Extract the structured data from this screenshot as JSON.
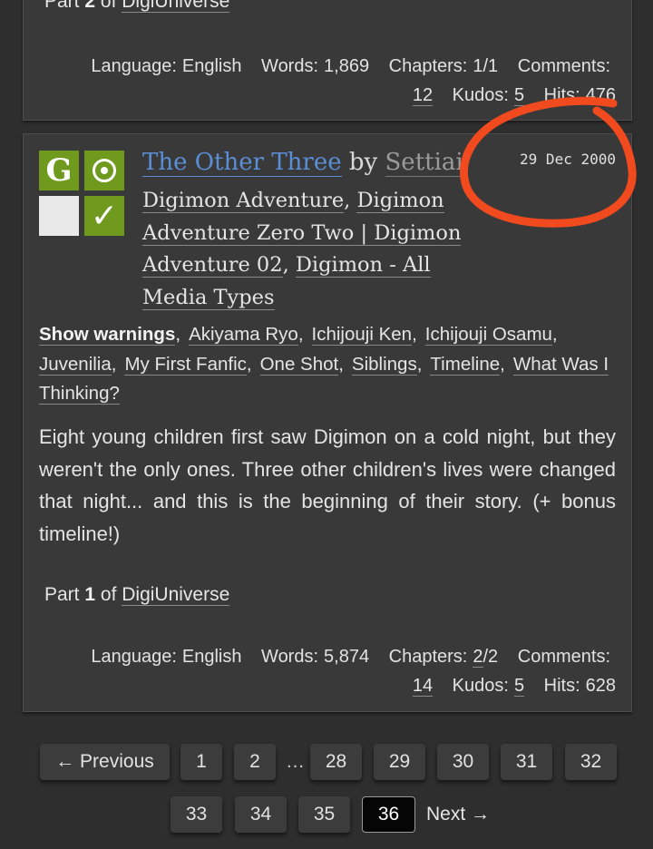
{
  "works": [
    {
      "series": {
        "prefix": "Part",
        "part": "2",
        "of": "of",
        "name": "DigiUniverse"
      },
      "stats": {
        "language_label": "Language:",
        "language": "English",
        "words_label": "Words:",
        "words": "1,869",
        "chapters_label": "Chapters:",
        "chapters": "1/1",
        "comments_label": "Comments:",
        "comments": "12",
        "kudos_label": "Kudos:",
        "kudos": "5",
        "hits_label": "Hits:",
        "hits": "476"
      }
    },
    {
      "icons": {
        "rating": "G",
        "rating_icon": "rating-general-icon",
        "category_icon": "category-gen-icon",
        "warning_icon": "warning-none-icon",
        "complete_icon": "complete-checkmark-icon",
        "complete_glyph": "✓"
      },
      "title": "The Other Three",
      "by": "by",
      "author": "Settiai",
      "date": "29 Dec 2000",
      "fandoms": [
        "Digimon Adventure",
        "Digimon Adventure Zero Two | Digimon Adventure 02",
        "Digimon - All Media Types"
      ],
      "tags": [
        "Show warnings",
        "Akiyama Ryo",
        "Ichijouji Ken",
        "Ichijouji Osamu",
        "Juvenilia",
        "My First Fanfic",
        "One Shot",
        "Siblings",
        "Timeline",
        "What Was I Thinking?"
      ],
      "summary": "Eight young children first saw Digimon on a cold night, but they weren't the only ones. Three other children's lives were changed that night... and this is the beginning of their story. (+ bonus timeline!)",
      "series": {
        "prefix": "Part",
        "part": "1",
        "of": "of",
        "name": "DigiUniverse"
      },
      "stats": {
        "language_label": "Language:",
        "language": "English",
        "words_label": "Words:",
        "words": "5,874",
        "chapters_label": "Chapters:",
        "chapters_current": "2",
        "chapters_total": "/2",
        "comments_label": "Comments:",
        "comments": "14",
        "kudos_label": "Kudos:",
        "kudos": "5",
        "hits_label": "Hits:",
        "hits": "628"
      }
    }
  ],
  "pagination": {
    "previous": "← Previous",
    "row1": [
      "1",
      "2",
      "28",
      "29",
      "30",
      "31",
      "32"
    ],
    "gap": "…",
    "row2": [
      "33",
      "34",
      "35"
    ],
    "current": "36",
    "next": "Next →"
  },
  "annotation": {
    "color": "#f04a1e"
  },
  "colors": {
    "background": "#2e2e2e",
    "card": "#393939",
    "link_blue": "#5a8fd6",
    "rating_green": "#6f9a1d"
  }
}
